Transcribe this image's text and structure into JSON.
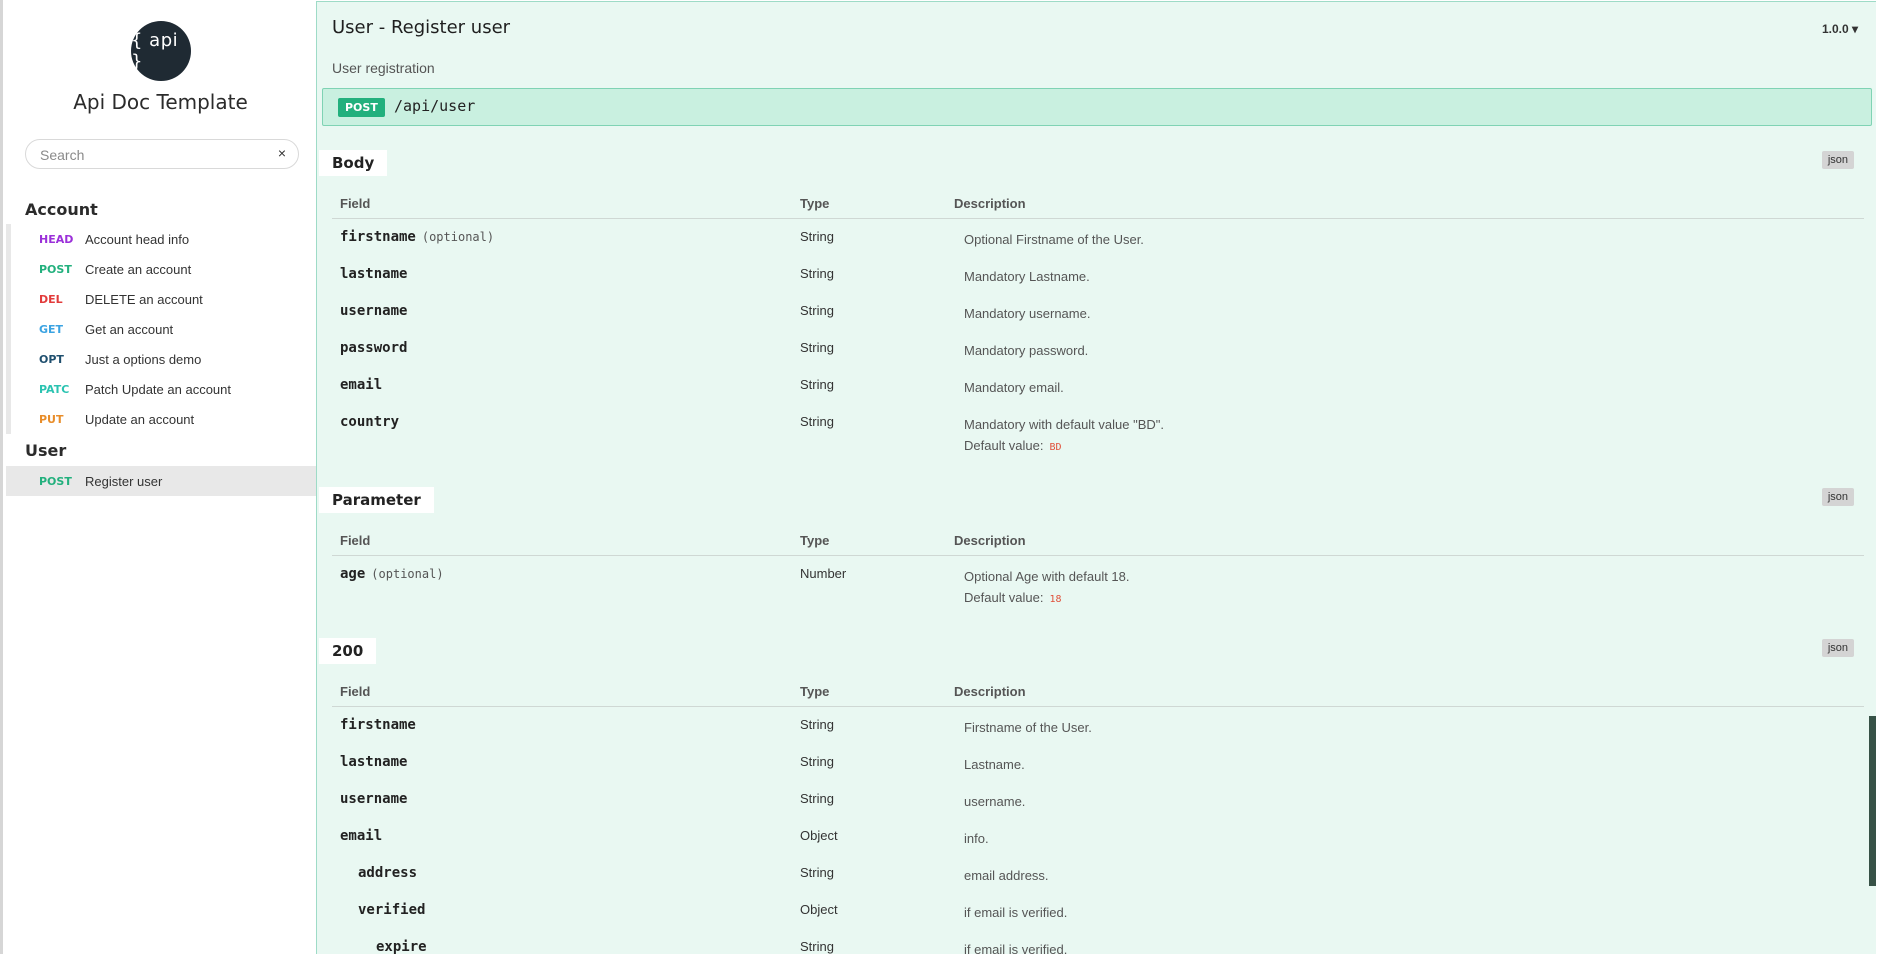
{
  "sidebar": {
    "logo_text": "{ api }",
    "app_title": "Api Doc Template",
    "search": {
      "placeholder": "Search",
      "value": "",
      "clear": "×"
    },
    "groups": [
      {
        "title": "Account",
        "items": [
          {
            "method": "HEAD",
            "label": "Account head info",
            "color": "#9b30d9"
          },
          {
            "method": "POST",
            "label": "Create an account",
            "color": "#22b07d"
          },
          {
            "method": "DEL",
            "label": "DELETE an account",
            "color": "#e23b3b"
          },
          {
            "method": "GET",
            "label": "Get an account",
            "color": "#3ba3e2"
          },
          {
            "method": "OPT",
            "label": "Just a options demo",
            "color": "#1f4f6e"
          },
          {
            "method": "PATC",
            "label": "Patch Update an account",
            "color": "#2bc3b1"
          },
          {
            "method": "PUT",
            "label": "Update an account",
            "color": "#e88d2a"
          }
        ]
      },
      {
        "title": "User",
        "items": [
          {
            "method": "POST",
            "label": "Register user",
            "color": "#22b07d",
            "active": true
          }
        ]
      }
    ]
  },
  "main": {
    "title": "User - Register user",
    "version": "1.0.0 ▾",
    "subtitle": "User registration",
    "endpoint": {
      "method": "POST",
      "path": "/api/user"
    },
    "headers": {
      "field": "Field",
      "type": "Type",
      "description": "Description"
    },
    "json_label": "json",
    "default_label": "Default value:",
    "sections": [
      {
        "title": "Body",
        "rows": [
          {
            "field": "firstname",
            "optional": "(optional)",
            "type": "String",
            "desc": "Optional Firstname of the User."
          },
          {
            "field": "lastname",
            "type": "String",
            "desc": "Mandatory Lastname."
          },
          {
            "field": "username",
            "type": "String",
            "desc": "Mandatory username."
          },
          {
            "field": "password",
            "type": "String",
            "desc": "Mandatory password."
          },
          {
            "field": "email",
            "type": "String",
            "desc": "Mandatory email."
          },
          {
            "field": "country",
            "type": "String",
            "desc": "Mandatory with default value \"BD\".",
            "default": "BD"
          }
        ]
      },
      {
        "title": "Parameter",
        "rows": [
          {
            "field": "age",
            "optional": "(optional)",
            "type": "Number",
            "desc": "Optional Age with default 18.",
            "default": "18"
          }
        ]
      },
      {
        "title": "200",
        "rows": [
          {
            "field": "firstname",
            "type": "String",
            "desc": "Firstname of the User."
          },
          {
            "field": "lastname",
            "type": "String",
            "desc": "Lastname."
          },
          {
            "field": "username",
            "type": "String",
            "desc": "username."
          },
          {
            "field": "email",
            "type": "Object",
            "desc": "info."
          },
          {
            "field": "address",
            "type": "String",
            "desc": "email address.",
            "level": 1
          },
          {
            "field": "verified",
            "type": "Object",
            "desc": "if email is verified.",
            "level": 1
          },
          {
            "field": "expire",
            "type": "String",
            "desc": "if email is verified.",
            "level": 2
          }
        ]
      }
    ]
  }
}
